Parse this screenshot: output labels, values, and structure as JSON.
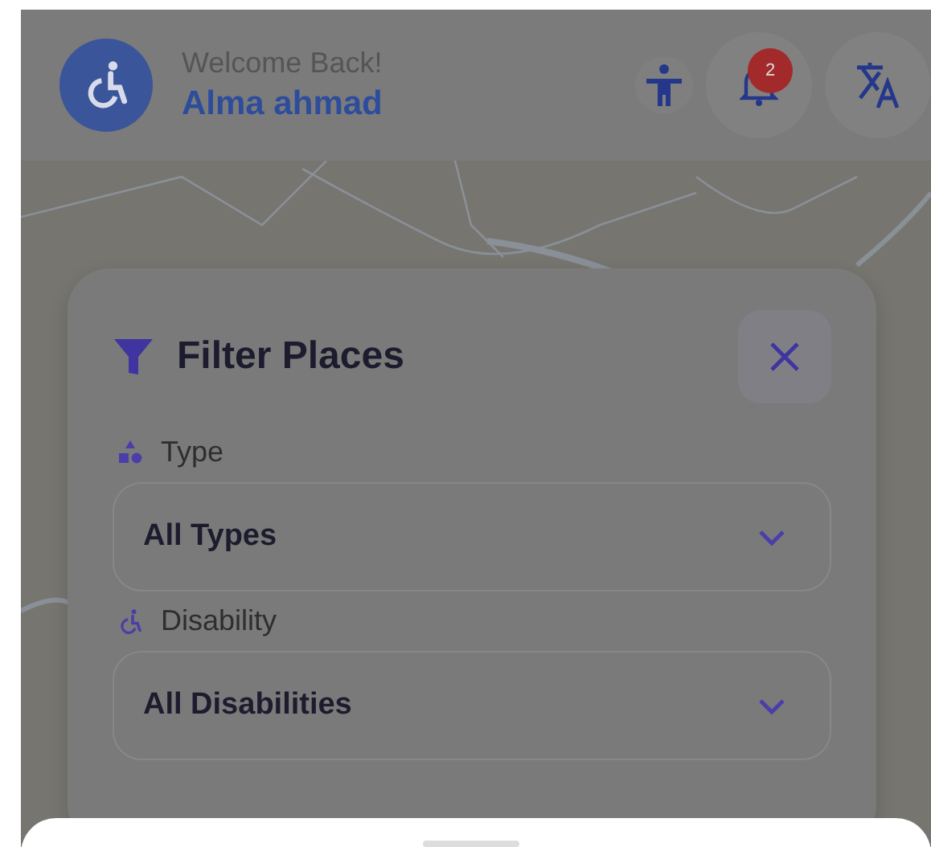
{
  "header": {
    "greeting": "Welcome Back!",
    "user_name": "Alma ahmad",
    "notification_count": "2"
  },
  "filter_panel": {
    "title": "Filter Places",
    "fields": [
      {
        "kind": "type",
        "label": "Type",
        "value": "All Types"
      },
      {
        "kind": "disability",
        "label": "Disability",
        "value": "All Disabilities"
      }
    ]
  }
}
